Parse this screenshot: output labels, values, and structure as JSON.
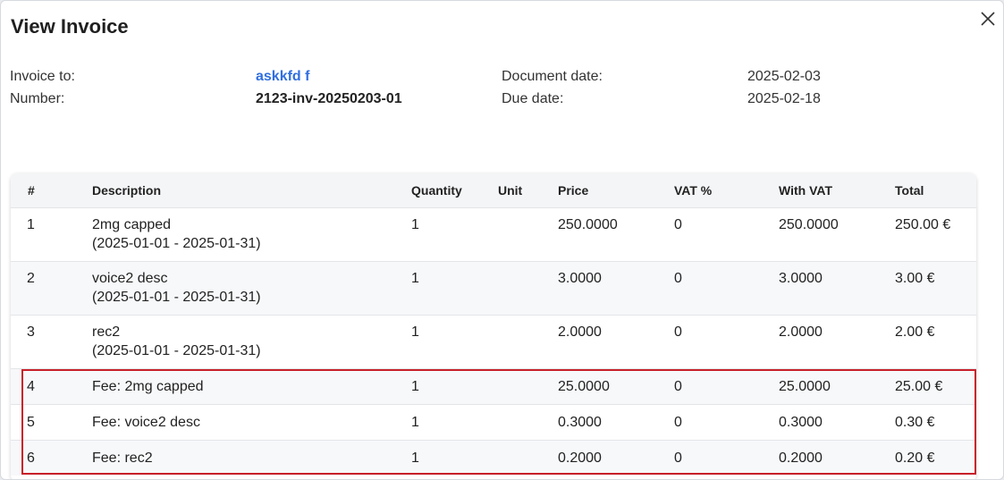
{
  "dialog": {
    "title": "View Invoice",
    "close_icon": "close-icon"
  },
  "meta": {
    "invoice_to_label": "Invoice to:",
    "invoice_to_value": "askkfd f",
    "number_label": "Number:",
    "number_value": "2123-inv-20250203-01",
    "document_date_label": "Document date:",
    "document_date_value": "2025-02-03",
    "due_date_label": "Due date:",
    "due_date_value": "2025-02-18"
  },
  "table": {
    "headers": [
      "#",
      "Description",
      "Quantity",
      "Unit",
      "Price",
      "VAT %",
      "With VAT",
      "Total"
    ],
    "rows": [
      {
        "num": "1",
        "description": "2mg capped",
        "period": "(2025-01-01 - 2025-01-31)",
        "quantity": "1",
        "unit": "",
        "price": "250.0000",
        "vat": "0",
        "with_vat": "250.0000",
        "total": "250.00 €"
      },
      {
        "num": "2",
        "description": "voice2 desc",
        "period": "(2025-01-01 - 2025-01-31)",
        "quantity": "1",
        "unit": "",
        "price": "3.0000",
        "vat": "0",
        "with_vat": "3.0000",
        "total": "3.00 €"
      },
      {
        "num": "3",
        "description": "rec2",
        "period": "(2025-01-01 - 2025-01-31)",
        "quantity": "1",
        "unit": "",
        "price": "2.0000",
        "vat": "0",
        "with_vat": "2.0000",
        "total": "2.00 €"
      },
      {
        "num": "4",
        "description": "Fee: 2mg capped",
        "period": "",
        "quantity": "1",
        "unit": "",
        "price": "25.0000",
        "vat": "0",
        "with_vat": "25.0000",
        "total": "25.00 €"
      },
      {
        "num": "5",
        "description": "Fee: voice2 desc",
        "period": "",
        "quantity": "1",
        "unit": "",
        "price": "0.3000",
        "vat": "0",
        "with_vat": "0.3000",
        "total": "0.30 €"
      },
      {
        "num": "6",
        "description": "Fee: rec2",
        "period": "",
        "quantity": "1",
        "unit": "",
        "price": "0.2000",
        "vat": "0",
        "with_vat": "0.2000",
        "total": "0.20 €"
      }
    ]
  },
  "colors": {
    "link": "#2f6fe0",
    "highlight_border": "#c8202a",
    "header_bg": "#f4f5f7"
  }
}
